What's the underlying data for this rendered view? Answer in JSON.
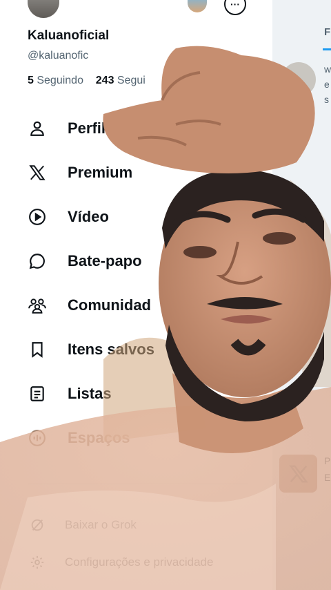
{
  "profile": {
    "display_name": "Kaluanoficial",
    "handle": "@kaluanofic",
    "following_count": "5",
    "following_label": "Seguindo",
    "followers_count": "243",
    "followers_label": "Segui"
  },
  "menu": {
    "items": [
      {
        "label": "Perfil",
        "icon": "person-icon"
      },
      {
        "label": "Premium",
        "icon": "x-logo-icon"
      },
      {
        "label": "Vídeo",
        "icon": "play-icon"
      },
      {
        "label": "Bate-papo",
        "icon": "chat-bubble-icon"
      },
      {
        "label": "Comunidad",
        "icon": "communities-icon"
      },
      {
        "label": "Itens salvos",
        "icon": "bookmark-icon"
      },
      {
        "label": "Listas",
        "icon": "list-icon"
      },
      {
        "label": "Espaços",
        "icon": "spaces-icon"
      }
    ]
  },
  "footer": {
    "grok_label": "Baixar o Grok",
    "settings_label": "Configurações e privacidade"
  },
  "feed_peek": {
    "tab_label": "F",
    "row1": "w",
    "row2": "e",
    "row3": "s",
    "row4": "P",
    "row5": "E"
  },
  "colors": {
    "accent": "#1d9bf0",
    "text": "#0f1419",
    "muted": "#536471",
    "skin_overlay": "#c98e70"
  }
}
